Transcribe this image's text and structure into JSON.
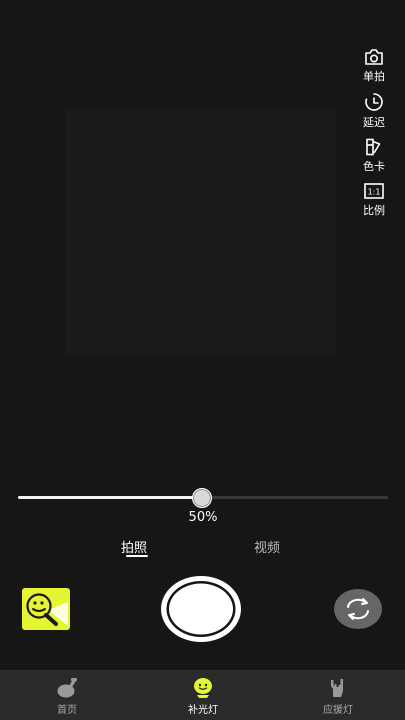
{
  "camera_tools": {
    "burst_label": "单拍",
    "delay_label": "延迟",
    "color_card_label": "色卡",
    "ratio_label": "比例",
    "ratio_icon_text": "1:1"
  },
  "brightness": {
    "value_text": "50%",
    "level_fraction": 0.5
  },
  "modes": {
    "photo_label": "拍照",
    "video_label": "视频",
    "selected": "photo"
  },
  "bottom_nav": {
    "home_label": "首页",
    "fill_light_label": "补光灯",
    "cheer_light_label": "应援灯",
    "selected": "fill_light"
  },
  "colors": {
    "accent": "#e6f531",
    "background": "#161616",
    "tabbar": "#2b2b2b"
  }
}
